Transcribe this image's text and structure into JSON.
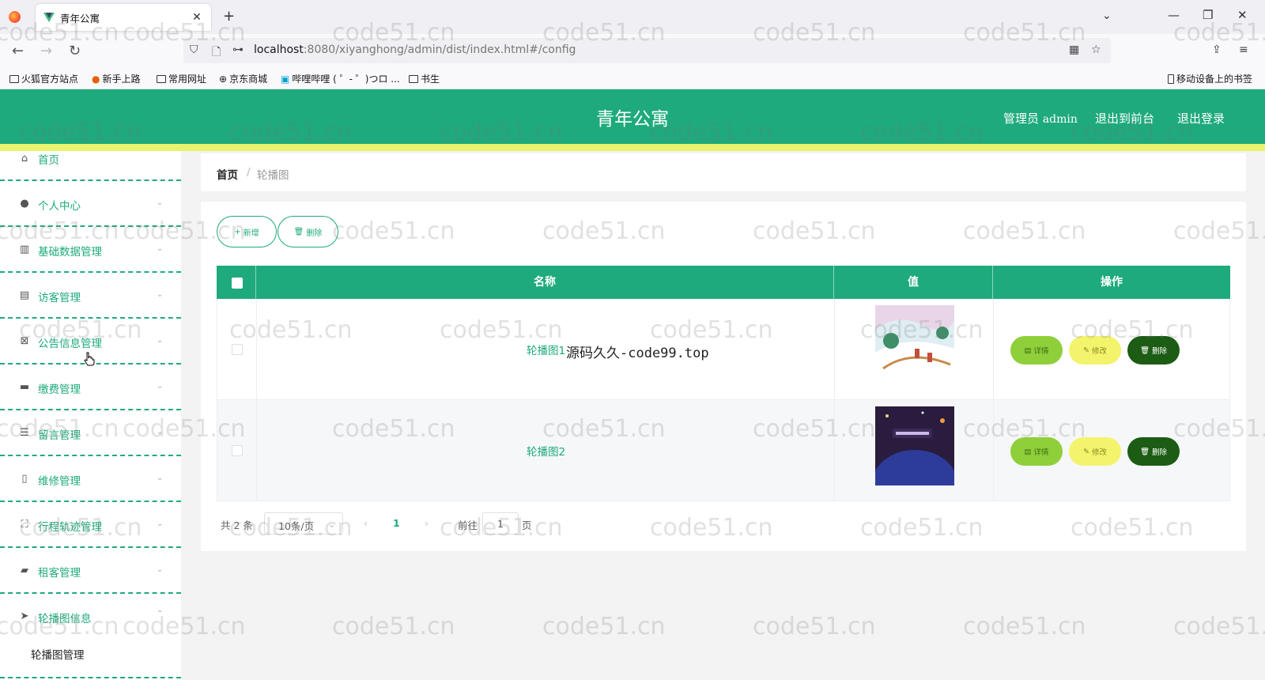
{
  "browser": {
    "tab_title": "青年公寓",
    "url_host": "localhost",
    "url_rest": ":8080/xiyanghong/admin/dist/index.html#/config",
    "bookmarks": [
      "火狐官方站点",
      "新手上路",
      "常用网址",
      "京东商城",
      "哔哩哔哩 ( ゜- ゜)つロ ...",
      "书生"
    ],
    "mobile_bookmarks": "移动设备上的书签"
  },
  "header": {
    "title": "青年公寓",
    "admin_label": "管理员",
    "admin_user": "admin",
    "to_front": "退出到前台",
    "logout": "退出登录"
  },
  "sidebar": {
    "items": [
      {
        "label": "首页",
        "icon": "home-icon"
      },
      {
        "label": "个人中心",
        "icon": "user-icon"
      },
      {
        "label": "基础数据管理",
        "icon": "chart-icon"
      },
      {
        "label": "访客管理",
        "icon": "clipboard-icon"
      },
      {
        "label": "公告信息管理",
        "icon": "notice-icon"
      },
      {
        "label": "缴费管理",
        "icon": "briefcase-icon"
      },
      {
        "label": "留言管理",
        "icon": "message-icon"
      },
      {
        "label": "维修管理",
        "icon": "tool-icon"
      },
      {
        "label": "行程轨迹管理",
        "icon": "route-icon"
      },
      {
        "label": "租客管理",
        "icon": "ticket-icon"
      },
      {
        "label": "轮播图信息",
        "icon": "send-icon"
      }
    ],
    "sub_item": "轮播图管理"
  },
  "breadcrumb": {
    "home": "首页",
    "sep": "/",
    "current": "轮播图"
  },
  "toolbar": {
    "add": "新增",
    "delete": "删除"
  },
  "table": {
    "columns": [
      "名称",
      "值",
      "操作"
    ],
    "rows": [
      {
        "name": "轮播图1"
      },
      {
        "name": "轮播图2"
      }
    ],
    "actions": {
      "detail": "详情",
      "edit": "修改",
      "delete": "删除"
    }
  },
  "overlay_text": "源码久久-code99.top",
  "pagination": {
    "total": "共 2 条",
    "page_size": "10条/页",
    "current_page": "1",
    "goto_label": "前往",
    "goto_value": "1",
    "page_suffix": "页"
  },
  "watermark": "code51.cn",
  "colors": {
    "primary": "#1eaa7c",
    "stripe": "#e9f36d",
    "detail_button": "#8fcf3a",
    "edit_button": "#f3f46c",
    "delete_button": "#1c5c14"
  }
}
